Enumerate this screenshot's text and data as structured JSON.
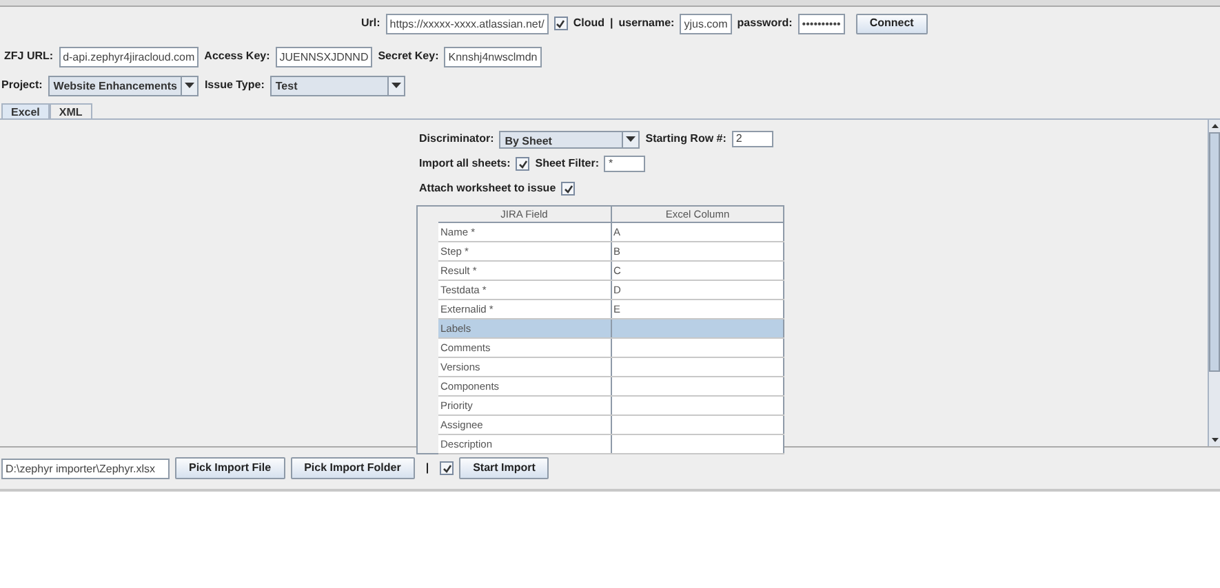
{
  "connection": {
    "url_label": "Url:",
    "url": "https://xxxxx-xxxx.atlassian.net/",
    "cloud": {
      "label": "Cloud",
      "checked": true
    },
    "separator": "|",
    "username_label": "username:",
    "username": "yjus.com",
    "password_label": "password:",
    "password": "••••••••••",
    "connect": "Connect"
  },
  "keys": {
    "zfj_url_label": "ZFJ URL:",
    "zfj_url": "d-api.zephyr4jiracloud.com",
    "access_key_label": "Access Key:",
    "access_key": "JUENNSXJDNND",
    "secret_key_label": "Secret Key:",
    "secret_key": "Knnshj4nwsclmdn"
  },
  "project": {
    "project_label": "Project:",
    "project": "Website Enhancements",
    "issue_type_label": "Issue Type:",
    "issue_type": "Test"
  },
  "tabs": [
    {
      "label": "Excel",
      "selected": true
    },
    {
      "label": "XML",
      "selected": false
    }
  ],
  "excel": {
    "discriminator_label": "Discriminator:",
    "discriminator": "By Sheet",
    "starting_row_label": "Starting Row #:",
    "starting_row": "2",
    "import_all_label": "Import all sheets:",
    "import_all": true,
    "sheet_filter_label": "Sheet Filter:",
    "sheet_filter": "*",
    "attach_label": "Attach worksheet to issue",
    "attach": true,
    "table": {
      "columns": [
        "JIRA Field",
        "Excel Column"
      ],
      "rows": [
        {
          "field": "Name *",
          "column": "A",
          "selected": false
        },
        {
          "field": "Step *",
          "column": "B",
          "selected": false
        },
        {
          "field": "Result *",
          "column": "C",
          "selected": false
        },
        {
          "field": "Testdata *",
          "column": "D",
          "selected": false
        },
        {
          "field": "Externalid *",
          "column": "E",
          "selected": false
        },
        {
          "field": "Labels",
          "column": "",
          "selected": true
        },
        {
          "field": "Comments",
          "column": "",
          "selected": false
        },
        {
          "field": "Versions",
          "column": "",
          "selected": false
        },
        {
          "field": "Components",
          "column": "",
          "selected": false
        },
        {
          "field": "Priority",
          "column": "",
          "selected": false
        },
        {
          "field": "Assignee",
          "column": "",
          "selected": false
        },
        {
          "field": "Description",
          "column": "",
          "selected": false
        }
      ]
    }
  },
  "bottom": {
    "path": "D:\\zephyr importer\\Zephyr.xlsx",
    "pick_file": "Pick Import File",
    "pick_folder": "Pick Import Folder",
    "separator": "|",
    "checkbox": {
      "checked": true
    },
    "start": "Start Import"
  }
}
